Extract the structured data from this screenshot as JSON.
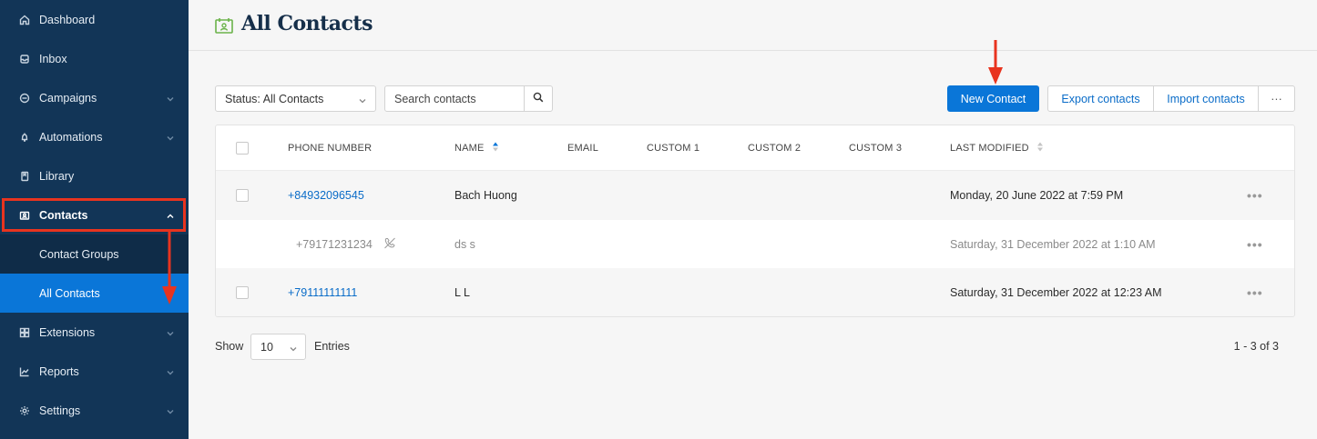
{
  "sidebar": {
    "items": [
      {
        "label": "Dashboard",
        "icon": "home-icon"
      },
      {
        "label": "Inbox",
        "icon": "inbox-icon"
      },
      {
        "label": "Campaigns",
        "icon": "campaigns-icon"
      },
      {
        "label": "Automations",
        "icon": "automations-icon"
      },
      {
        "label": "Library",
        "icon": "library-icon"
      },
      {
        "label": "Contacts",
        "icon": "contacts-icon"
      },
      {
        "label": "Contact Groups"
      },
      {
        "label": "All Contacts"
      },
      {
        "label": "Extensions",
        "icon": "extensions-icon"
      },
      {
        "label": "Reports",
        "icon": "reports-icon"
      },
      {
        "label": "Settings",
        "icon": "settings-icon"
      }
    ]
  },
  "header": {
    "title": "All Contacts"
  },
  "toolbar": {
    "status_select": "Status: All Contacts",
    "search_placeholder": "Search contacts",
    "new_contact": "New Contact",
    "export": "Export contacts",
    "import": "Import contacts",
    "more": "···"
  },
  "table": {
    "columns": [
      "PHONE NUMBER",
      "NAME",
      "EMAIL",
      "CUSTOM 1",
      "CUSTOM 2",
      "CUSTOM 3",
      "LAST MODIFIED"
    ],
    "rows": [
      {
        "phone": "+84932096545",
        "name": "Bach Huong",
        "email": "",
        "custom1": "",
        "custom2": "",
        "custom3": "",
        "modified": "Monday, 20 June 2022 at 7:59 PM"
      },
      {
        "phone": "+79171231234",
        "name": "ds s",
        "email": "",
        "custom1": "",
        "custom2": "",
        "custom3": "",
        "modified": "Saturday, 31 December 2022 at 1:10 AM"
      },
      {
        "phone": "+79111111111",
        "name": "L L",
        "email": "",
        "custom1": "",
        "custom2": "",
        "custom3": "",
        "modified": "Saturday, 31 December 2022 at 12:23 AM"
      }
    ],
    "row_menu": "•••"
  },
  "footer": {
    "show": "Show",
    "page_size": "10",
    "entries": "Entries",
    "range": "1 - 3 of 3"
  },
  "colors": {
    "sidebar_bg": "#123557",
    "accent": "#0a76d8",
    "annotation": "#e8341f"
  }
}
